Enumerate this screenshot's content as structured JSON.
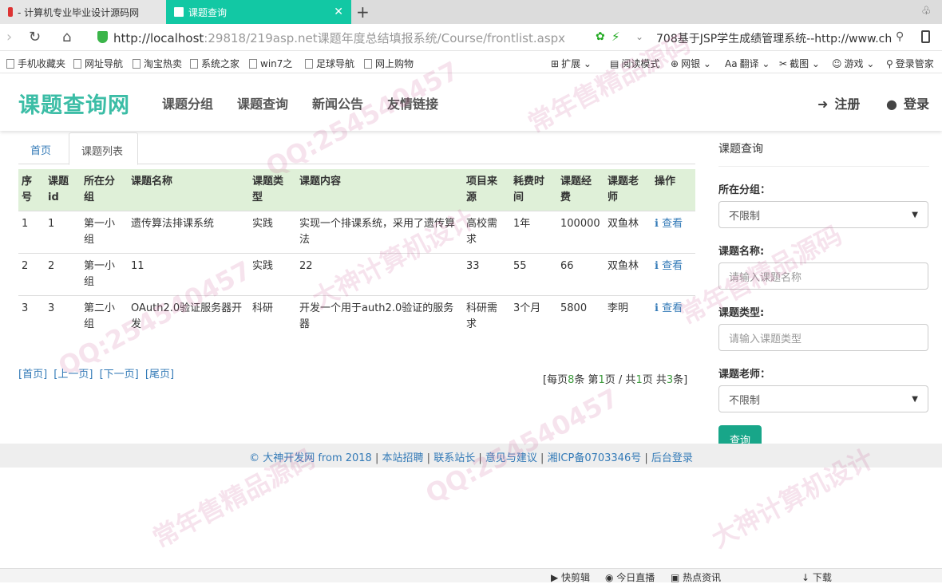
{
  "browser": {
    "tabs": [
      {
        "label": "- 计算机专业毕业设计源码网",
        "active": false
      },
      {
        "label": "课题查询",
        "active": true
      }
    ],
    "new_tab": "+",
    "url_host": "http://localhost",
    "url_rest": ":29818/219asp.net课题年度总结填报系统/Course/frontlist.aspx",
    "search_text": "708基于JSP学生成绩管理系统--http://www.ch",
    "bookmarks_left": [
      "手机收藏夹",
      "网址导航",
      "淘宝热卖",
      "系统之家",
      "win7之",
      "足球导航",
      "网上购物"
    ],
    "bookmarks_right": [
      "扩展",
      "阅读模式",
      "网银",
      "翻译",
      "截图",
      "游戏",
      "登录管家"
    ],
    "status_items": [
      "快剪辑",
      "今日直播",
      "热点资讯",
      "下载"
    ]
  },
  "site": {
    "logo": "课题查询网",
    "nav": [
      "课题分组",
      "课题查询",
      "新闻公告",
      "友情链接"
    ],
    "register": "注册",
    "login": "登录"
  },
  "content": {
    "tabs": [
      "首页",
      "课题列表"
    ],
    "columns": [
      "序号",
      "课题id",
      "所在分组",
      "课题名称",
      "课题类型",
      "课题内容",
      "项目来源",
      "耗费时间",
      "课题经费",
      "课题老师",
      "操作"
    ],
    "rows": [
      [
        "1",
        "1",
        "第一小组",
        "遗传算法排课系统",
        "实践",
        "实现一个排课系统，采用了遗传算法",
        "高校需求",
        "1年",
        "100000",
        "双鱼林",
        "查看"
      ],
      [
        "2",
        "2",
        "第一小组",
        "11",
        "实践",
        "22",
        "33",
        "55",
        "66",
        "双鱼林",
        "查看"
      ],
      [
        "3",
        "3",
        "第二小组",
        "OAuth2.0验证服务器开发",
        "科研",
        "开发一个用于auth2.0验证的服务器",
        "科研需求",
        "3个月",
        "5800",
        "李明",
        "查看"
      ]
    ],
    "pager": [
      "[首页]",
      "[上一页]",
      "[下一页]",
      "[尾页]"
    ],
    "page_info": {
      "prefix": "[每页",
      "per_page": "8",
      "mid1": "条 第",
      "current": "1",
      "mid2": "页 / 共",
      "total_pages": "1",
      "mid3": "页 共",
      "total": "3",
      "suffix": "条]"
    }
  },
  "query_panel": {
    "title": "课题查询",
    "group_label": "所在分组：",
    "group_value": "不限制",
    "name_label": "课题名称:",
    "name_placeholder": "请输入课题名称",
    "type_label": "课题类型:",
    "type_placeholder": "请输入课题类型",
    "teacher_label": "课题老师：",
    "teacher_value": "不限制",
    "submit": "查询"
  },
  "footer": {
    "copyright": "© 大神开发网 from 2018",
    "links": [
      "本站招聘",
      "联系站长",
      "意见与建议",
      "湘ICP备0703346号",
      "后台登录"
    ],
    "sep": "|"
  },
  "watermarks": [
    "QQ:254540457",
    "常年售精品源码",
    "大神计算机设计"
  ],
  "colors": {
    "accent": "#3cbda6",
    "active_tab": "#12c8a4",
    "header_row": "#dff0d8",
    "button": "#18a689",
    "link": "#337ab7"
  }
}
